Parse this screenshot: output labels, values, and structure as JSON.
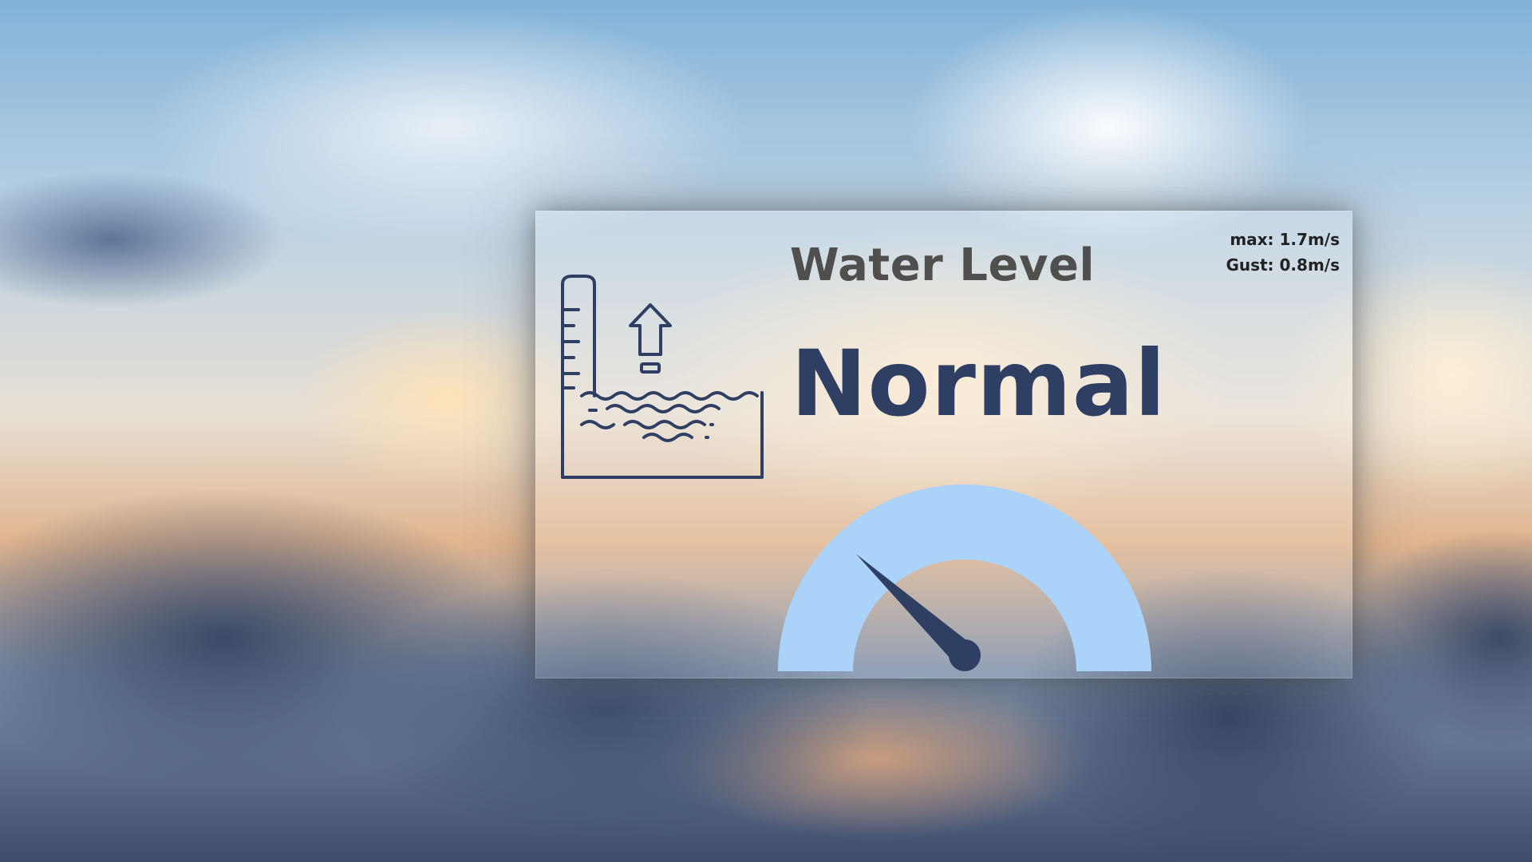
{
  "card": {
    "title": "Water Level",
    "status": "Normal",
    "stats": {
      "max": "max: 1.7m/s",
      "gust": "Gust: 0.8m/s"
    },
    "gauge": {
      "fill_color": "#abd2f8",
      "needle_color": "#2e3f63",
      "needle_level": 0.2
    },
    "colors": {
      "title": "#4f4f4f",
      "status": "#2e3f63",
      "icon": "#2e3f63"
    },
    "icons": {
      "water_level": "water-level-icon"
    }
  }
}
